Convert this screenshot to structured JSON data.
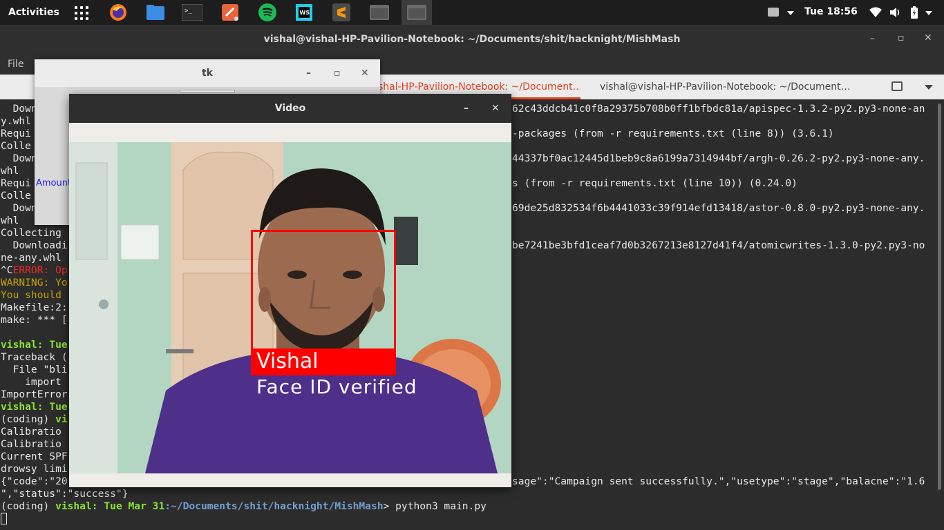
{
  "topbar": {
    "activities": "Activities",
    "clock": "Tue 18:56",
    "dock": [
      "firefox-icon",
      "files-icon",
      "terminal-icon",
      "postman-icon",
      "spotify-icon",
      "webstorm-icon",
      "sublime-icon",
      "window-icon",
      "window-icon"
    ]
  },
  "terminal": {
    "title": "vishal@vishal-HP-Pavilion-Notebook: ~/Documents/shit/hacknight/MishMash",
    "menu_file": "File",
    "tabs": [
      "vishal@vishal-HP-Pavilion-Notebook: ~/Document…",
      "vishal@vishal-HP-Pavilion-Notebook: ~/Document…"
    ],
    "left_lines": [
      "  Down",
      "y.whl",
      "Requi",
      "Colle",
      "  Down",
      "whl",
      "Requi",
      "Colle",
      "  Down",
      "whl",
      "Collecting",
      "  Downloadi",
      "ne-any.whl",
      "^C",
      "ERROR: Op",
      "WARNING: Yo",
      "You should",
      "Makefile:2:",
      "make: *** [",
      "",
      "vishal: Tue",
      "Traceback (",
      "  File \"bli",
      "    import ",
      "ImportError",
      "vishal: Tue",
      "(coding) vi",
      "Calibratio",
      "Calibratio",
      "Current SPF",
      "drowsy limi",
      "{\"code\":\"20"
    ],
    "right_lines": [
      "62c43ddcb41c0f8a29375b708b0ff1bfbdc81a/apispec-1.3.2-py2.py3-none-an",
      "-packages (from -r requirements.txt (line 8)) (3.6.1)",
      "44337bf0ac12445d1beb9c8a6199a7314944bf/argh-0.26.2-py2.py3-none-any.",
      "s (from -r requirements.txt (line 10)) (0.24.0)",
      "69de25d832534f6b4441033c39f914efd13418/astor-0.8.0-py2.py3-none-any.",
      "be7241be3bfd1ceaf7d0b3267213e8127d41f4/atomicwrites-1.3.0-py2.py3-no",
      "sage\":\"Campaign sent successfully.\",\"usetype\":\"stage\",\"balacne\":\"1.6"
    ],
    "status_line": "\",\"status\":\"success\"}",
    "prompt_env": "(coding) ",
    "prompt_user": "vishal: Tue Mar 31",
    "prompt_path": ":~/Documents/shit/hacknight/MishMash",
    "prompt_cmd": "> python3 main.py"
  },
  "tk_window": {
    "title": "tk",
    "label": "Amount"
  },
  "video_window": {
    "title": "Video",
    "face_name": "Vishal",
    "face_status": "Face ID verified",
    "box_color": "#ff0000"
  }
}
